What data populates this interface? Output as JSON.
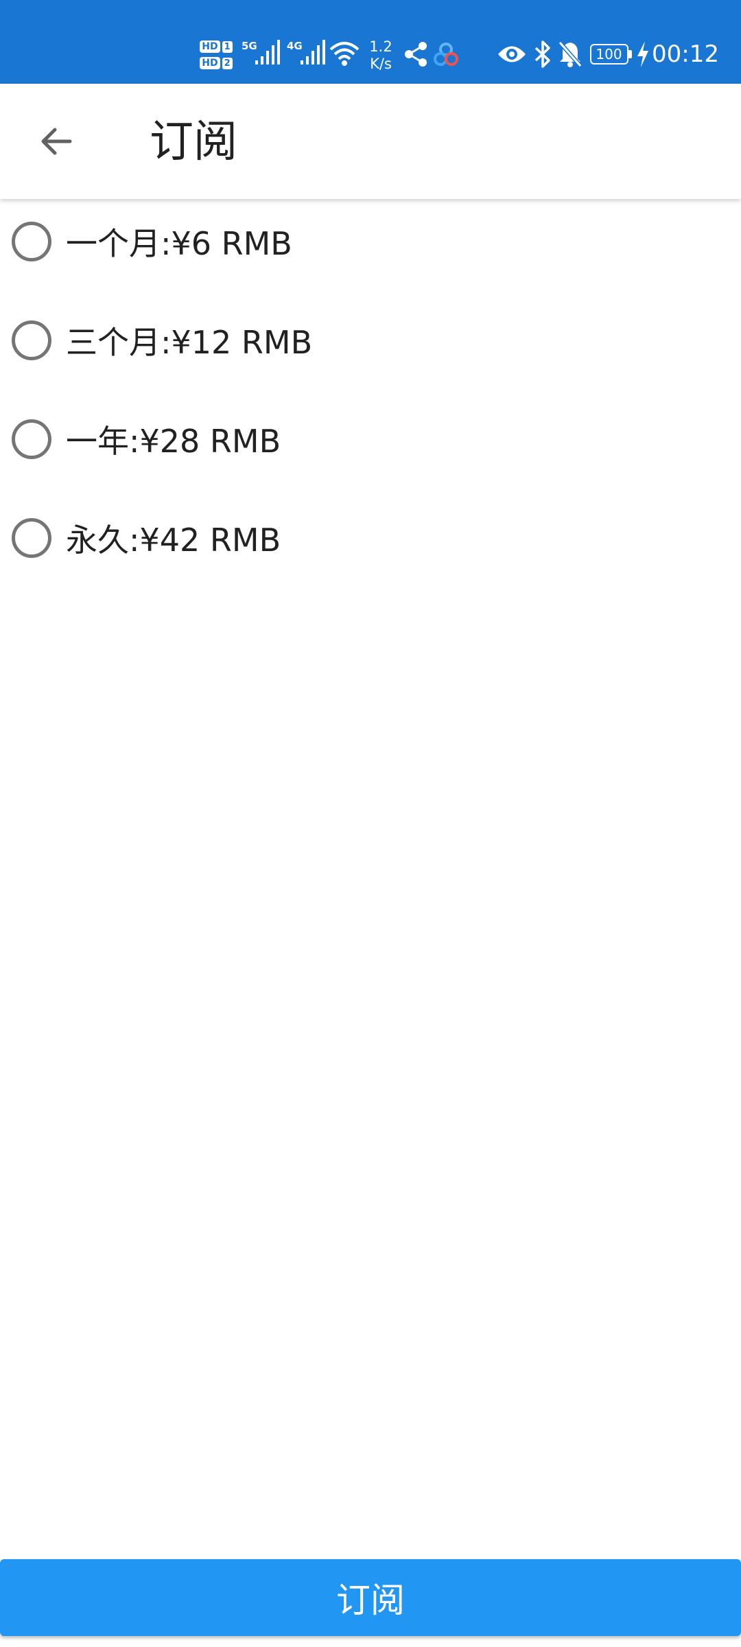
{
  "status_bar": {
    "hd1_label": "HD",
    "hd1_num": "1",
    "hd2_label": "HD",
    "hd2_num": "2",
    "net1": "5G",
    "net2": "4G",
    "speed_value": "1.2",
    "speed_unit": "K/s",
    "battery": "100",
    "time": "00:12",
    "icons": [
      "signal-icon",
      "wifi-icon",
      "share-icon",
      "app-icon",
      "eye-icon",
      "bluetooth-icon",
      "bell-off-icon",
      "battery-icon",
      "charging-icon"
    ],
    "background_color": "#1976D2"
  },
  "app_bar": {
    "title": "订阅",
    "back_icon": "arrow-back-icon"
  },
  "options": [
    {
      "label": "一个月:¥6 RMB",
      "selected": false
    },
    {
      "label": "三个月:¥12 RMB",
      "selected": false
    },
    {
      "label": "一年:¥28 RMB",
      "selected": false
    },
    {
      "label": "永久:¥42 RMB",
      "selected": false
    }
  ],
  "submit_button": {
    "label": "订阅",
    "color": "#2196F3"
  }
}
